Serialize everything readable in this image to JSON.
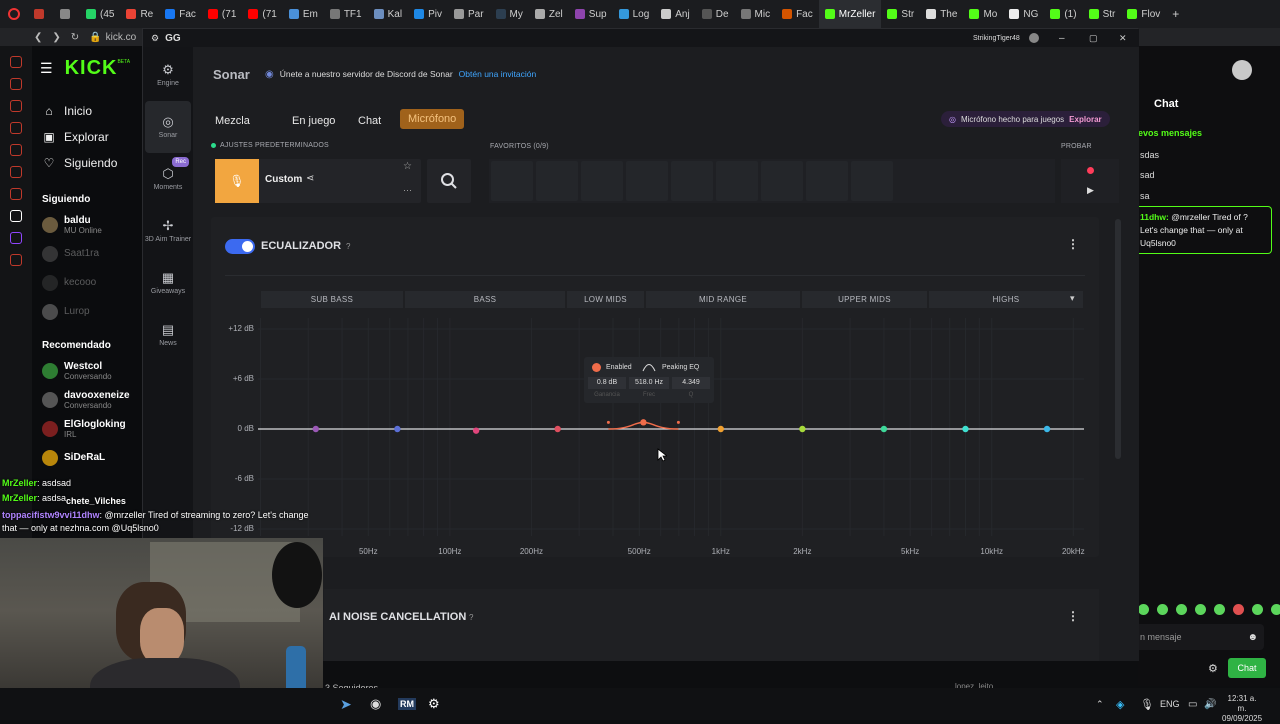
{
  "browser": {
    "tabs": [
      {
        "label": "",
        "color": "#c0392b"
      },
      {
        "label": "",
        "color": "#888"
      },
      {
        "label": "(45",
        "color": "#25d366"
      },
      {
        "label": "Re",
        "color": "#ea4335"
      },
      {
        "label": "Fac",
        "color": "#1877f2"
      },
      {
        "label": "(71",
        "color": "#ff0000"
      },
      {
        "label": "(71",
        "color": "#ff0000"
      },
      {
        "label": "Em",
        "color": "#4a90d9"
      },
      {
        "label": "TF1",
        "color": "#777"
      },
      {
        "label": "Kal",
        "color": "#6c8ebf"
      },
      {
        "label": "Piv",
        "color": "#1e88e5"
      },
      {
        "label": "Par",
        "color": "#999"
      },
      {
        "label": "My",
        "color": "#2c3e50"
      },
      {
        "label": "Zel",
        "color": "#aaa"
      },
      {
        "label": "Sup",
        "color": "#8e44ad"
      },
      {
        "label": "Log",
        "color": "#3498db"
      },
      {
        "label": "Anj",
        "color": "#ccc"
      },
      {
        "label": "De",
        "color": "#555"
      },
      {
        "label": "Mic",
        "color": "#777"
      },
      {
        "label": "Fac",
        "color": "#d35400"
      },
      {
        "label": "MrZeller",
        "color": "#53fc18"
      },
      {
        "label": "Str",
        "color": "#53fc18"
      },
      {
        "label": "The",
        "color": "#ddd"
      },
      {
        "label": "Mo",
        "color": "#53fc18"
      },
      {
        "label": "NG",
        "color": "#eee"
      },
      {
        "label": "(1)",
        "color": "#53fc18"
      },
      {
        "label": "Str",
        "color": "#53fc18"
      },
      {
        "label": "Flov",
        "color": "#53fc18"
      }
    ],
    "new_tab": "+",
    "address": "kick.co"
  },
  "kick": {
    "logo": "KICK",
    "logo_badge": "BETA",
    "nav": [
      {
        "label": "Inicio",
        "icon": "home-icon",
        "glyph": "⌂"
      },
      {
        "label": "Explorar",
        "icon": "browse-icon",
        "glyph": "▣"
      },
      {
        "label": "Siguiendo",
        "icon": "heart-icon",
        "glyph": "♡"
      }
    ],
    "following_header": "Siguiendo",
    "following": [
      {
        "name": "baldu",
        "sub": "MU Online",
        "dim": false,
        "color": "#6b5b3e"
      },
      {
        "name": "Saat1ra",
        "sub": "",
        "dim": true,
        "color": "#666"
      },
      {
        "name": "kecooo",
        "sub": "",
        "dim": true,
        "color": "#444"
      },
      {
        "name": "Lurop",
        "sub": "",
        "dim": true,
        "color": "#999"
      }
    ],
    "recommended_header": "Recomendado",
    "recommended": [
      {
        "name": "Westcol",
        "sub": "Conversando",
        "color": "#2e7d32"
      },
      {
        "name": "davooxeneize",
        "sub": "Conversando",
        "color": "#555"
      },
      {
        "name": "ElGlogloking",
        "sub": "IRL",
        "color": "#7b1f1f"
      },
      {
        "name": "SiDeRaL",
        "sub": "",
        "color": "#b8860b"
      }
    ]
  },
  "gg": {
    "icon_glyph": "⚙",
    "title": "GG",
    "user": "StrikingTiger48",
    "window_controls": [
      "–",
      "▢",
      "✕"
    ],
    "nav": [
      {
        "label": "Engine",
        "icon": "engine-icon",
        "glyph": "⚙",
        "active": false
      },
      {
        "label": "Sonar",
        "icon": "sonar-icon",
        "glyph": "◎",
        "active": true
      },
      {
        "label": "Moments",
        "icon": "moments-icon",
        "glyph": "⬡",
        "active": false,
        "badge": "Rec"
      },
      {
        "label": "3D Aim Trainer",
        "icon": "aim-icon",
        "glyph": "✢",
        "active": false
      },
      {
        "label": "Giveaways",
        "icon": "giveaways-icon",
        "glyph": "▦",
        "active": false
      },
      {
        "label": "News",
        "icon": "news-icon",
        "glyph": "▤",
        "active": false
      }
    ],
    "sonar": {
      "title": "Sonar",
      "discord_text": "Únete a nuestro servidor de Discord de Sonar",
      "discord_link": "Obtén una invitación",
      "tabs": [
        "Mezcla",
        "En juego",
        "Chat",
        "Micrófono"
      ],
      "selected_tab": "Micrófono",
      "mic_promo": "Micrófono hecho para juegos",
      "mic_promo_link": "Explorar",
      "presets_label": "AJUSTES PREDETERMINADOS",
      "preset_name": "Custom",
      "favorites_label": "FAVORITOS (0/9)",
      "test_label": "PROBAR",
      "eq": {
        "title": "ECUALIZADOR",
        "help": "?",
        "enabled": true,
        "bands": [
          "SUB BASS",
          "BASS",
          "LOW MIDS",
          "MID RANGE",
          "UPPER MIDS",
          "HIGHS"
        ],
        "y_labels": [
          "+12 dB",
          "+6 dB",
          "0 dB",
          "-6 dB",
          "-12 dB"
        ],
        "x_labels": [
          "50Hz",
          "100Hz",
          "200Hz",
          "500Hz",
          "1kHz",
          "2kHz",
          "5kHz",
          "10kHz",
          "20kHz"
        ],
        "tooltip": {
          "enabled_label": "Enabled",
          "type_label": "Peaking EQ",
          "gain": "0.8 dB",
          "freq": "518.0 Hz",
          "q": "4.349",
          "gain_caption": "Ganancia",
          "freq_caption": "Frec",
          "q_caption": "Q"
        },
        "points": [
          {
            "freq": 32,
            "gain": 0,
            "color": "#9b59b6"
          },
          {
            "freq": 64,
            "gain": 0,
            "color": "#5b6fd6"
          },
          {
            "freq": 125,
            "gain": -0.2,
            "color": "#e0457b"
          },
          {
            "freq": 250,
            "gain": 0,
            "color": "#e04f5f"
          },
          {
            "freq": 518,
            "gain": 0.8,
            "color": "#ef6c4a"
          },
          {
            "freq": 1000,
            "gain": 0,
            "color": "#f0a030"
          },
          {
            "freq": 2000,
            "gain": 0,
            "color": "#a6d93b"
          },
          {
            "freq": 4000,
            "gain": 0,
            "color": "#3ed89a"
          },
          {
            "freq": 8000,
            "gain": 0,
            "color": "#3ee0d0"
          },
          {
            "freq": 16000,
            "gain": 0,
            "color": "#3bb8e8"
          }
        ]
      },
      "noise": {
        "title": "AI NOISE CANCELLATION",
        "help": "?"
      }
    }
  },
  "twitch": {
    "chat_header": "Chat",
    "new_messages": "evos mensajes",
    "lines": [
      "sdas",
      "sad",
      "sa"
    ],
    "highlight": {
      "user": "11dhw:",
      "text": "@mrzeller Tired of ? Let's change that — only at Uq5lsno0"
    },
    "input_placeholder": "n mensaje",
    "send": "Chat"
  },
  "overlay_chat": [
    {
      "user": "MrZeller",
      "text": "asdsad",
      "color": "#53fc18"
    },
    {
      "user": "MrZeller",
      "text": "asdsa",
      "color": "#53fc18"
    },
    {
      "user": "toppacifistw9vvi11dhw",
      "text": "@mrzeller Tired of streaming to zero? Let's change that — only at nezhna.com @Uq5lsno0",
      "color": "#b084ff"
    }
  ],
  "overlay_misc": {
    "name_fragment": "chete_Vilches",
    "followers": "3 Seguidores",
    "footer_user": "lopez_leito"
  },
  "taskbar": {
    "lang": "ENG",
    "time": "12:31 a. m.",
    "date": "09/09/2025"
  }
}
